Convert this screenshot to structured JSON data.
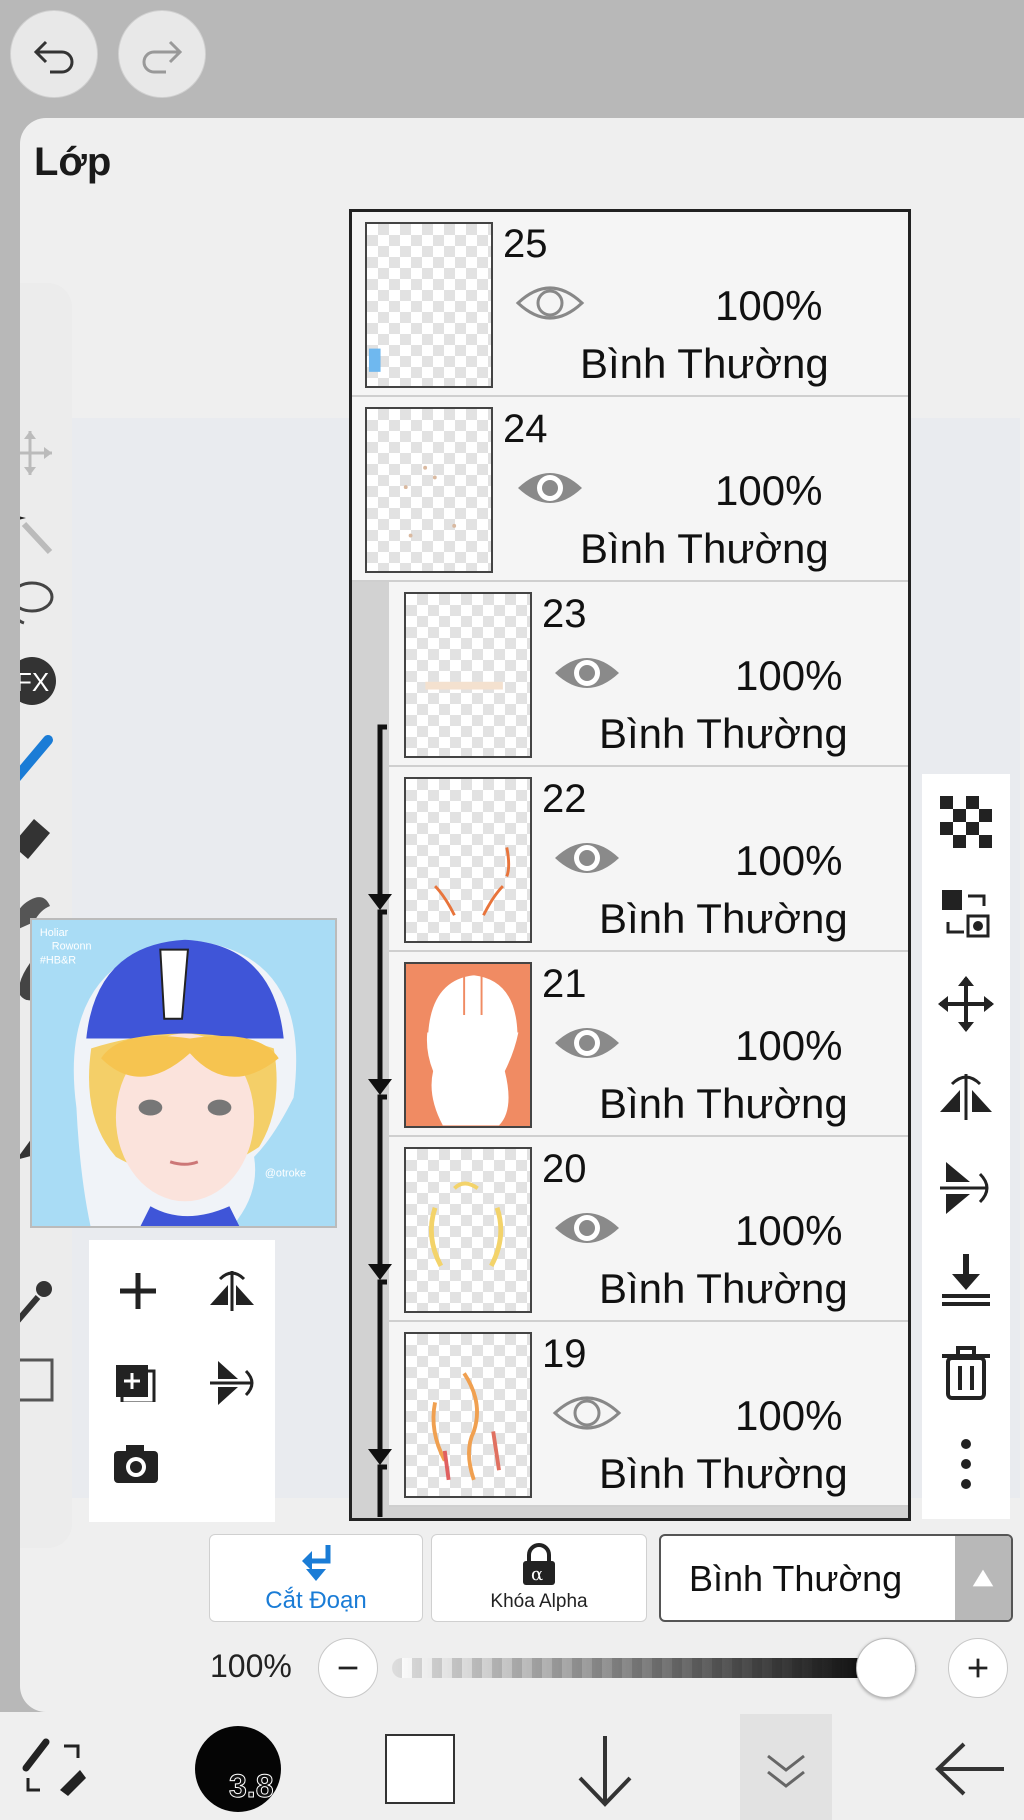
{
  "toolbar": {
    "undo_icon": "undo-icon",
    "redo_icon": "redo-icon"
  },
  "panel": {
    "title": "Lớp"
  },
  "layers": [
    {
      "number": "25",
      "opacity": "100%",
      "blend": "Bình Thường",
      "visible": true,
      "clipped": false
    },
    {
      "number": "24",
      "opacity": "100%",
      "blend": "Bình Thường",
      "visible": true,
      "clipped": false
    },
    {
      "number": "23",
      "opacity": "100%",
      "blend": "Bình Thường",
      "visible": true,
      "clipped": true
    },
    {
      "number": "22",
      "opacity": "100%",
      "blend": "Bình Thường",
      "visible": true,
      "clipped": true
    },
    {
      "number": "21",
      "opacity": "100%",
      "blend": "Bình Thường",
      "visible": true,
      "clipped": true
    },
    {
      "number": "20",
      "opacity": "100%",
      "blend": "Bình Thường",
      "visible": true,
      "clipped": true
    },
    {
      "number": "19",
      "opacity": "100%",
      "blend": "Bình Thường",
      "visible": false,
      "clipped": true
    }
  ],
  "layer_actions": {
    "clip_label": "Cắt Đoạn",
    "alpha_lock_label": "Khóa Alpha",
    "blend_mode_value": "Bình Thường"
  },
  "opacity_control": {
    "label": "100%",
    "value_fraction": 1.0
  },
  "bottom_bar": {
    "brush_size": "3.8"
  },
  "colors": {
    "accent_blue": "#1a7cd6",
    "orange_layer": "#f08b63",
    "panel_bg": "#efefef"
  }
}
